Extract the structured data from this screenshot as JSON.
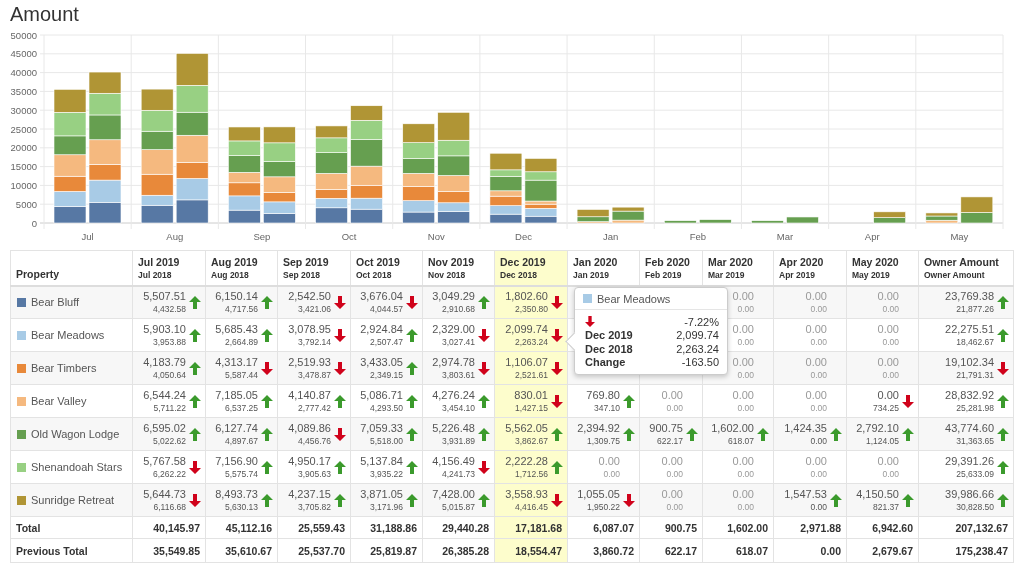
{
  "title": "Amount",
  "chart": {
    "y_axis_labels": [
      "50000",
      "45000",
      "40000",
      "35000",
      "30000",
      "25000",
      "20000",
      "15000",
      "10000",
      "5000",
      "0"
    ],
    "x_axis_labels": [
      "Jul",
      "Aug",
      "Sep",
      "Oct",
      "Nov",
      "Dec",
      "Jan",
      "Feb",
      "Mar",
      "Apr",
      "May"
    ]
  },
  "table": {
    "property_header": "Property",
    "columns": [
      {
        "label": "Jul 2019",
        "sublabel": "Jul 2018",
        "selected": false
      },
      {
        "label": "Aug 2019",
        "sublabel": "Aug 2018",
        "selected": false
      },
      {
        "label": "Sep 2019",
        "sublabel": "Sep 2018",
        "selected": false
      },
      {
        "label": "Oct 2019",
        "sublabel": "Oct 2018",
        "selected": false
      },
      {
        "label": "Nov 2019",
        "sublabel": "Nov 2018",
        "selected": false
      },
      {
        "label": "Dec 2019",
        "sublabel": "Dec 2018",
        "selected": true
      },
      {
        "label": "Jan 2020",
        "sublabel": "Jan 2019",
        "selected": false
      },
      {
        "label": "Feb 2020",
        "sublabel": "Feb 2019",
        "selected": false
      },
      {
        "label": "Mar 2020",
        "sublabel": "Mar 2019",
        "selected": false
      },
      {
        "label": "Apr 2020",
        "sublabel": "Apr 2019",
        "selected": false
      },
      {
        "label": "May 2020",
        "sublabel": "May 2019",
        "selected": false
      },
      {
        "label": "Owner Amount",
        "sublabel": "Owner Amount",
        "selected": false
      }
    ],
    "rows": [
      {
        "property": "Bear Bluff",
        "color": "#5778a4",
        "cells": [
          {
            "value": "5,507.51",
            "previous": "4,432.58",
            "kind": "up"
          },
          {
            "value": "6,150.14",
            "previous": "4,717.56",
            "kind": "up"
          },
          {
            "value": "2,542.50",
            "previous": "3,421.06",
            "kind": "down"
          },
          {
            "value": "3,676.04",
            "previous": "4,044.57",
            "kind": "down"
          },
          {
            "value": "3,049.29",
            "previous": "2,910.68",
            "kind": "up"
          },
          {
            "value": "1,802.60",
            "previous": "2,350.80",
            "kind": "down"
          },
          null,
          null,
          {
            "value": "0.00",
            "previous": "0.00",
            "kind": "flat"
          },
          {
            "value": "0.00",
            "previous": "0.00",
            "kind": "flat"
          },
          {
            "value": "0.00",
            "previous": "0.00",
            "kind": "flat"
          },
          {
            "value": "23,769.38",
            "previous": "21,877.26",
            "kind": "up"
          }
        ]
      },
      {
        "property": "Bear Meadows",
        "color": "#a8cbe6",
        "cells": [
          {
            "value": "5,903.10",
            "previous": "3,953.88",
            "kind": "up"
          },
          {
            "value": "5,685.43",
            "previous": "2,664.89",
            "kind": "up"
          },
          {
            "value": "3,078.95",
            "previous": "3,792.14",
            "kind": "down"
          },
          {
            "value": "2,924.84",
            "previous": "2,507.47",
            "kind": "up"
          },
          {
            "value": "2,329.00",
            "previous": "3,027.41",
            "kind": "down"
          },
          {
            "value": "2,099.74",
            "previous": "2,263.24",
            "kind": "down"
          },
          null,
          null,
          {
            "value": "0.00",
            "previous": "0.00",
            "kind": "flat"
          },
          {
            "value": "0.00",
            "previous": "0.00",
            "kind": "flat"
          },
          {
            "value": "0.00",
            "previous": "0.00",
            "kind": "flat"
          },
          {
            "value": "22,275.51",
            "previous": "18,462.67",
            "kind": "up"
          }
        ]
      },
      {
        "property": "Bear Timbers",
        "color": "#e8893a",
        "cells": [
          {
            "value": "4,183.79",
            "previous": "4,050.64",
            "kind": "up"
          },
          {
            "value": "4,313.17",
            "previous": "5,587.44",
            "kind": "down"
          },
          {
            "value": "2,519.93",
            "previous": "3,478.87",
            "kind": "down"
          },
          {
            "value": "3,433.05",
            "previous": "2,349.15",
            "kind": "up"
          },
          {
            "value": "2,974.78",
            "previous": "3,803.61",
            "kind": "down"
          },
          {
            "value": "1,106.07",
            "previous": "2,521.61",
            "kind": "down"
          },
          null,
          null,
          {
            "value": "0.00",
            "previous": "0.00",
            "kind": "flat"
          },
          {
            "value": "0.00",
            "previous": "0.00",
            "kind": "flat"
          },
          {
            "value": "0.00",
            "previous": "0.00",
            "kind": "flat"
          },
          {
            "value": "19,102.34",
            "previous": "21,791.31",
            "kind": "down"
          }
        ]
      },
      {
        "property": "Bear Valley",
        "color": "#f5b97f",
        "cells": [
          {
            "value": "6,544.24",
            "previous": "5,711.22",
            "kind": "up"
          },
          {
            "value": "7,185.05",
            "previous": "6,537.25",
            "kind": "up"
          },
          {
            "value": "4,140.87",
            "previous": "2,777.42",
            "kind": "up"
          },
          {
            "value": "5,086.71",
            "previous": "4,293.50",
            "kind": "up"
          },
          {
            "value": "4,276.24",
            "previous": "3,454.10",
            "kind": "up"
          },
          {
            "value": "830.01",
            "previous": "1,427.15",
            "kind": "down"
          },
          {
            "value": "769.80",
            "previous": "347.10",
            "kind": "up"
          },
          {
            "value": "0.00",
            "previous": "0.00",
            "kind": "flat"
          },
          {
            "value": "0.00",
            "previous": "0.00",
            "kind": "flat"
          },
          {
            "value": "0.00",
            "previous": "0.00",
            "kind": "flat"
          },
          {
            "value": "0.00",
            "previous": "734.25",
            "kind": "down"
          },
          {
            "value": "28,832.92",
            "previous": "25,281.98",
            "kind": "up"
          }
        ]
      },
      {
        "property": "Old Wagon Lodge",
        "color": "#669f50",
        "cells": [
          {
            "value": "6,595.02",
            "previous": "5,022.62",
            "kind": "up"
          },
          {
            "value": "6,127.74",
            "previous": "4,897.67",
            "kind": "up"
          },
          {
            "value": "4,089.86",
            "previous": "4,456.76",
            "kind": "down"
          },
          {
            "value": "7,059.33",
            "previous": "5,518.00",
            "kind": "up"
          },
          {
            "value": "5,226.48",
            "previous": "3,931.89",
            "kind": "up"
          },
          {
            "value": "5,562.05",
            "previous": "3,862.67",
            "kind": "up"
          },
          {
            "value": "2,394.92",
            "previous": "1,309.75",
            "kind": "up"
          },
          {
            "value": "900.75",
            "previous": "622.17",
            "kind": "up"
          },
          {
            "value": "1,602.00",
            "previous": "618.07",
            "kind": "up"
          },
          {
            "value": "1,424.35",
            "previous": "0.00",
            "kind": "up"
          },
          {
            "value": "2,792.10",
            "previous": "1,124.05",
            "kind": "up"
          },
          {
            "value": "43,774.60",
            "previous": "31,363.65",
            "kind": "up"
          }
        ]
      },
      {
        "property": "Shenandoah Stars",
        "color": "#98d083",
        "cells": [
          {
            "value": "5,767.58",
            "previous": "6,262.22",
            "kind": "down"
          },
          {
            "value": "7,156.90",
            "previous": "5,575.74",
            "kind": "up"
          },
          {
            "value": "4,950.17",
            "previous": "3,905.63",
            "kind": "up"
          },
          {
            "value": "5,137.84",
            "previous": "3,935.22",
            "kind": "up"
          },
          {
            "value": "4,156.49",
            "previous": "4,241.73",
            "kind": "down"
          },
          {
            "value": "2,222.28",
            "previous": "1,712.56",
            "kind": "up"
          },
          {
            "value": "0.00",
            "previous": "0.00",
            "kind": "flat"
          },
          {
            "value": "0.00",
            "previous": "0.00",
            "kind": "flat"
          },
          {
            "value": "0.00",
            "previous": "0.00",
            "kind": "flat"
          },
          {
            "value": "0.00",
            "previous": "0.00",
            "kind": "flat"
          },
          {
            "value": "0.00",
            "previous": "0.00",
            "kind": "flat"
          },
          {
            "value": "29,391.26",
            "previous": "25,633.09",
            "kind": "up"
          }
        ]
      },
      {
        "property": "Sunridge Retreat",
        "color": "#b09535",
        "cells": [
          {
            "value": "5,644.73",
            "previous": "6,116.68",
            "kind": "down"
          },
          {
            "value": "8,493.73",
            "previous": "5,630.13",
            "kind": "up"
          },
          {
            "value": "4,237.15",
            "previous": "3,705.82",
            "kind": "up"
          },
          {
            "value": "3,871.05",
            "previous": "3,171.96",
            "kind": "up"
          },
          {
            "value": "7,428.00",
            "previous": "5,015.87",
            "kind": "up"
          },
          {
            "value": "3,558.93",
            "previous": "4,416.45",
            "kind": "down"
          },
          {
            "value": "1,055.05",
            "previous": "1,950.22",
            "kind": "down"
          },
          {
            "value": "0.00",
            "previous": "0.00",
            "kind": "flat"
          },
          {
            "value": "0.00",
            "previous": "0.00",
            "kind": "flat"
          },
          {
            "value": "1,547.53",
            "previous": "0.00",
            "kind": "up"
          },
          {
            "value": "4,150.50",
            "previous": "821.37",
            "kind": "up"
          },
          {
            "value": "39,986.66",
            "previous": "30,828.50",
            "kind": "up"
          }
        ]
      }
    ],
    "totals": [
      {
        "label": "Total",
        "values": [
          "40,145.97",
          "45,112.16",
          "25,559.43",
          "31,188.86",
          "29,440.28",
          "17,181.68",
          "6,087.07",
          "900.75",
          "1,602.00",
          "2,971.88",
          "6,942.60",
          "207,132.67"
        ]
      },
      {
        "label": "Previous Total",
        "values": [
          "35,549.85",
          "35,610.67",
          "25,537.70",
          "25,819.87",
          "26,385.28",
          "18,554.47",
          "3,860.72",
          "622.17",
          "618.07",
          "0.00",
          "2,679.67",
          "175,238.47"
        ]
      }
    ]
  },
  "tooltip": {
    "title": "Bear Meadows",
    "color": "#a8cbe6",
    "kind": "down",
    "change": "-7.22%",
    "rows": [
      {
        "label": "Dec 2019",
        "value": "2,099.74"
      },
      {
        "label": "Dec 2018",
        "value": "2,263.24"
      },
      {
        "label": "Change",
        "value": "-163.50"
      }
    ]
  }
}
